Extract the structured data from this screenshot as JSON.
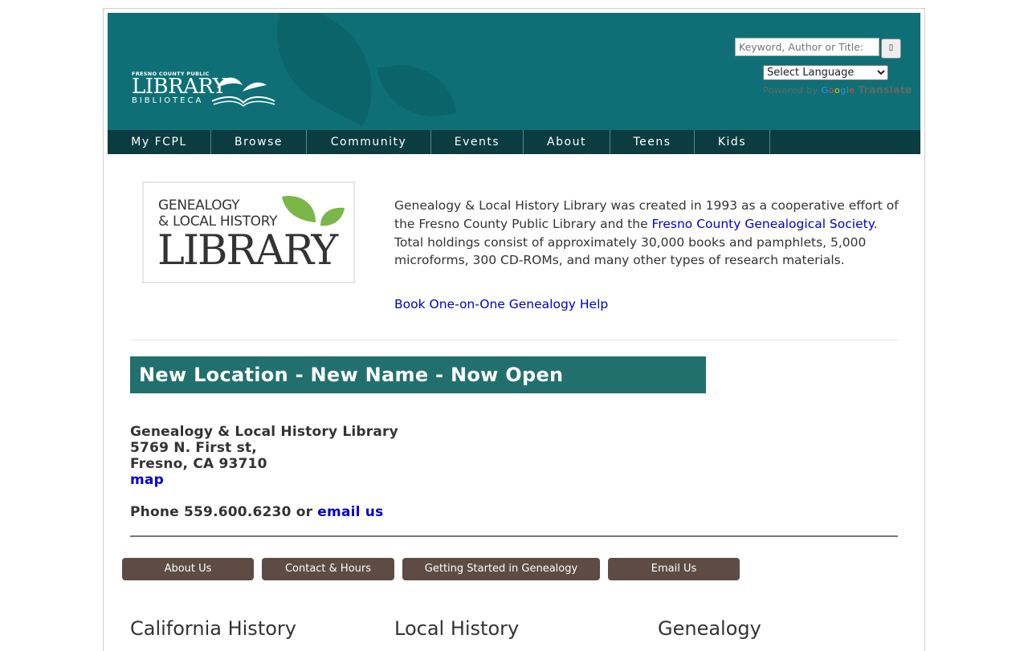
{
  "header": {
    "logo": {
      "small": "FRESNO COUNTY PUBLIC",
      "main": "LIBRARY",
      "sub": "BIBLIOTECA"
    },
    "search": {
      "placeholder": "Keyword, Author or Title:",
      "button_icon": "search-icon"
    },
    "language": {
      "selected": "Select Language",
      "powered_by": "Powered by",
      "google": "Google",
      "translate": "Translate"
    }
  },
  "nav": [
    {
      "label": "My FCPL"
    },
    {
      "label": "Browse"
    },
    {
      "label": "Community"
    },
    {
      "label": "Events"
    },
    {
      "label": "About"
    },
    {
      "label": "Teens"
    },
    {
      "label": "Kids"
    }
  ],
  "gen_logo": {
    "line1": "GENEALOGY",
    "line2": "& LOCAL HISTORY",
    "line3": "LIBRARY"
  },
  "intro": {
    "text_before": "Genealogy & Local History Library was created in 1993 as a cooperative effort of the Fresno County Public Library and the ",
    "link": "Fresno County Genealogical Society",
    "text_after": ". Total holdings consist of approximately 30,000 books and pamphlets, 5,000 microforms, 300 CD-ROMs, and many other types of research materials."
  },
  "book_link": "Book One-on-One Genealogy Help",
  "banner": "New Location - New Name - Now Open",
  "address": {
    "name": "Genealogy & Local History Library",
    "street": "5769 N. First st,",
    "city": "Fresno, CA 93710",
    "map_link": "map"
  },
  "phone": {
    "text": "Phone 559.600.6230 or ",
    "email_link": "email us"
  },
  "buttons": [
    {
      "label": "About Us"
    },
    {
      "label": "Contact & Hours"
    },
    {
      "label": "Getting Started in Genealogy"
    },
    {
      "label": "Email Us"
    }
  ],
  "columns": [
    {
      "heading": "California History"
    },
    {
      "heading": "Local History"
    },
    {
      "heading": "Genealogy"
    }
  ],
  "colors": {
    "header_bg": "#0e7076",
    "nav_bg": "#0b3c40",
    "banner_bg": "#21706e",
    "button_bg": "#5e4b44",
    "link": "#0000cc"
  }
}
